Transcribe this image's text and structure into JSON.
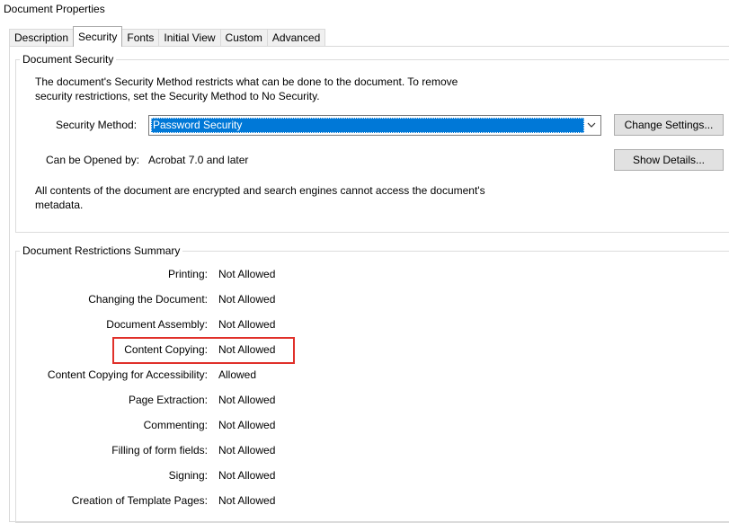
{
  "window": {
    "title": "Document Properties"
  },
  "tabs": [
    "Description",
    "Security",
    "Fonts",
    "Initial View",
    "Custom",
    "Advanced"
  ],
  "active_tab": "Security",
  "document_security": {
    "legend": "Document Security",
    "intro_line1": "The document's Security Method restricts what can be done to the document. To remove",
    "intro_line2": "security restrictions, set the Security Method to No Security.",
    "method_label": "Security Method:",
    "method_value": "Password Security",
    "change_settings_label": "Change Settings...",
    "opened_by_label": "Can be Opened by:",
    "opened_by_value": "Acrobat 7.0 and later",
    "show_details_label": "Show Details...",
    "note_line1": "All contents of the document are encrypted and search engines cannot access the document's",
    "note_line2": "metadata."
  },
  "restrictions": {
    "legend": "Document Restrictions Summary",
    "rows": [
      {
        "label": "Printing:",
        "value": "Not Allowed"
      },
      {
        "label": "Changing the Document:",
        "value": "Not Allowed"
      },
      {
        "label": "Document Assembly:",
        "value": "Not Allowed"
      },
      {
        "label": "Content Copying:",
        "value": "Not Allowed"
      },
      {
        "label": "Content Copying for Accessibility:",
        "value": "Allowed"
      },
      {
        "label": "Page Extraction:",
        "value": "Not Allowed"
      },
      {
        "label": "Commenting:",
        "value": "Not Allowed"
      },
      {
        "label": "Filling of form fields:",
        "value": "Not Allowed"
      },
      {
        "label": "Signing:",
        "value": "Not Allowed"
      },
      {
        "label": "Creation of Template Pages:",
        "value": "Not Allowed"
      }
    ]
  },
  "colors": {
    "selection": "#0078d7",
    "annotation": "#e0302a"
  }
}
